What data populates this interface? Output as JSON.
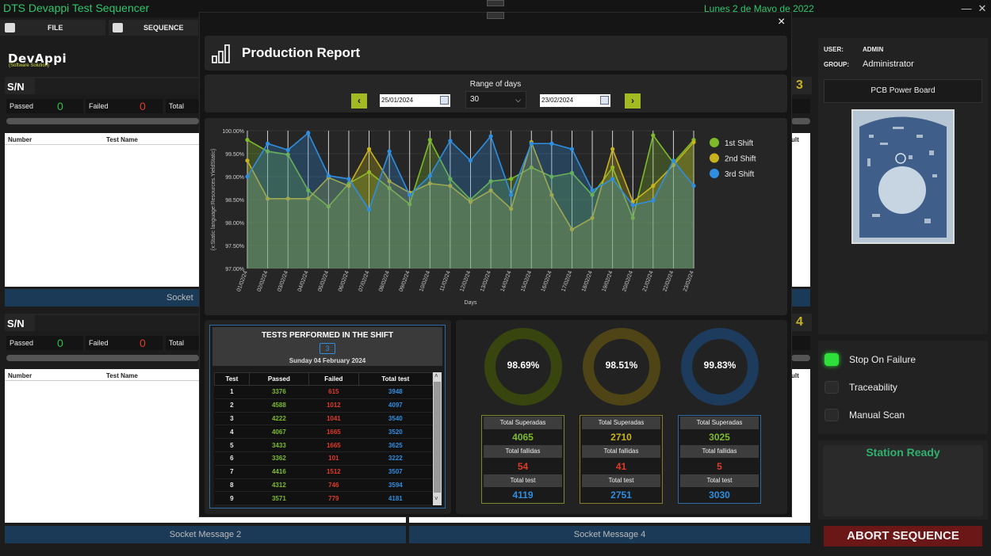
{
  "app": {
    "title": "DTS Devappi Test Sequencer",
    "date": "Lunes 2 de Mayo de 2022"
  },
  "menu": {
    "file": "FILE",
    "sequence": "SEQUENCE"
  },
  "logo": {
    "text": "DevAppi",
    "subtitle": "(Software Solution)"
  },
  "stations": [
    {
      "sn_label": "S/N",
      "passed_label": "Passed",
      "passed": "0",
      "failed_label": "Failed",
      "failed": "0",
      "total_label": "Total",
      "col_number": "Number",
      "col_test_name": "Test Name",
      "socket_message": "Socket"
    },
    {
      "sn_label": "S/N",
      "passed_label": "Passed",
      "passed": "0",
      "failed_label": "Failed",
      "failed": "0",
      "total_label": "Total",
      "col_number": "Number",
      "col_test_name": "Test Name",
      "socket_message": "Socket Message 2"
    }
  ],
  "right_partial": {
    "number_top": "3",
    "number_bottom": "4",
    "col_result_top": "ult",
    "col_result_bottom": "ult",
    "socket_message_4": "Socket Message 4"
  },
  "user": {
    "user_label": "USER:",
    "user_value": "ADMIN",
    "group_label": "GROUP:",
    "group_value": "Administrator"
  },
  "product": {
    "name": "PCB Power Board"
  },
  "options": [
    {
      "label": "Stop On Failure",
      "on": true
    },
    {
      "label": "Traceability",
      "on": false
    },
    {
      "label": "Manual Scan",
      "on": false
    }
  ],
  "status": {
    "text": "Station Ready",
    "abort_label": "ABORT SEQUENCE"
  },
  "report": {
    "title": "Production Report",
    "close_label": "×",
    "range_label": "Range of days",
    "start_date": "25/01/2024",
    "days": "30",
    "end_date": "23/02/2024"
  },
  "chart_data": {
    "type": "line",
    "ylabel": "{x:Static language:Resources.YieldStatic}",
    "xlabel": "Days",
    "ylim": [
      97.0,
      100.0
    ],
    "yticks": [
      "97.00%",
      "97.50%",
      "98.00%",
      "98.50%",
      "99.00%",
      "99.50%",
      "100.00%"
    ],
    "categories": [
      "01/02/24",
      "02/02/24",
      "03/02/24",
      "04/02/24",
      "05/02/24",
      "06/02/24",
      "07/02/24",
      "08/02/24",
      "09/02/24",
      "10/02/24",
      "11/02/24",
      "12/02/24",
      "13/02/24",
      "14/02/24",
      "15/02/24",
      "16/02/24",
      "17/02/24",
      "18/02/24",
      "19/02/24",
      "20/02/24",
      "21/02/24",
      "22/02/24",
      "23/02/24"
    ],
    "legend": "right",
    "series": [
      {
        "name": "1st Shift",
        "color": "#7dbb2a",
        "values": [
          99.8,
          99.55,
          99.48,
          98.7,
          98.35,
          98.85,
          99.1,
          98.75,
          98.4,
          99.8,
          98.95,
          98.5,
          98.9,
          98.95,
          99.2,
          99.0,
          99.08,
          98.6,
          99.2,
          98.1,
          99.9,
          99.3,
          99.8
        ]
      },
      {
        "name": "2nd Shift",
        "color": "#c8b21e",
        "values": [
          99.35,
          98.52,
          98.52,
          98.52,
          98.98,
          98.8,
          99.6,
          98.9,
          98.65,
          98.85,
          98.8,
          98.45,
          98.7,
          98.3,
          99.75,
          98.6,
          97.85,
          98.1,
          99.6,
          98.45,
          98.8,
          99.25,
          99.75
        ]
      },
      {
        "name": "3rd Shift",
        "color": "#2f8ee0",
        "values": [
          99.0,
          99.72,
          99.58,
          99.95,
          99.02,
          98.95,
          98.28,
          99.55,
          98.6,
          99.02,
          99.78,
          99.35,
          99.88,
          98.6,
          99.72,
          99.72,
          99.6,
          98.7,
          98.95,
          98.38,
          98.48,
          99.35,
          98.8
        ]
      }
    ]
  },
  "shift_panel": {
    "title": "TESTS PERFORMED IN THE SHIFT",
    "shift": "3",
    "date": "Sunday 04 February 2024",
    "columns": [
      "Test",
      "Passed",
      "Failed",
      "Total test"
    ],
    "rows": [
      [
        "1",
        "3376",
        "615",
        "3948"
      ],
      [
        "2",
        "4588",
        "1012",
        "4097"
      ],
      [
        "3",
        "4222",
        "1041",
        "3540"
      ],
      [
        "4",
        "4067",
        "1665",
        "3520"
      ],
      [
        "5",
        "3433",
        "1665",
        "3625"
      ],
      [
        "6",
        "3362",
        "101",
        "3222"
      ],
      [
        "7",
        "4416",
        "1512",
        "3507"
      ],
      [
        "8",
        "4312",
        "746",
        "3594"
      ],
      [
        "9",
        "3571",
        "779",
        "4181"
      ]
    ]
  },
  "donuts": [
    {
      "pct_text": "98.69%",
      "value": 98.69,
      "color": "#39450f",
      "border": "#7d8a2c",
      "superadas_label": "Total Superadas",
      "superadas": "4065",
      "fallidas_label": "Total fallidas",
      "fallidas": "54",
      "total_label": "Total test",
      "total": "4119",
      "sup_color": "#7dbb2a"
    },
    {
      "pct_text": "98.51%",
      "value": 98.51,
      "color": "#4f4415",
      "border": "#8b7b24",
      "superadas_label": "Total Superadas",
      "superadas": "2710",
      "fallidas_label": "Total fallidas",
      "fallidas": "41",
      "total_label": "Total test",
      "total": "2751",
      "sup_color": "#c8b21e"
    },
    {
      "pct_text": "99.83%",
      "value": 99.83,
      "color": "#1d3b5c",
      "border": "#2e6aa3",
      "superadas_label": "Total Superadas",
      "superadas": "3025",
      "fallidas_label": "Total fallidas",
      "fallidas": "5",
      "total_label": "Total test",
      "total": "3030",
      "sup_color": "#7dbb2a"
    }
  ]
}
